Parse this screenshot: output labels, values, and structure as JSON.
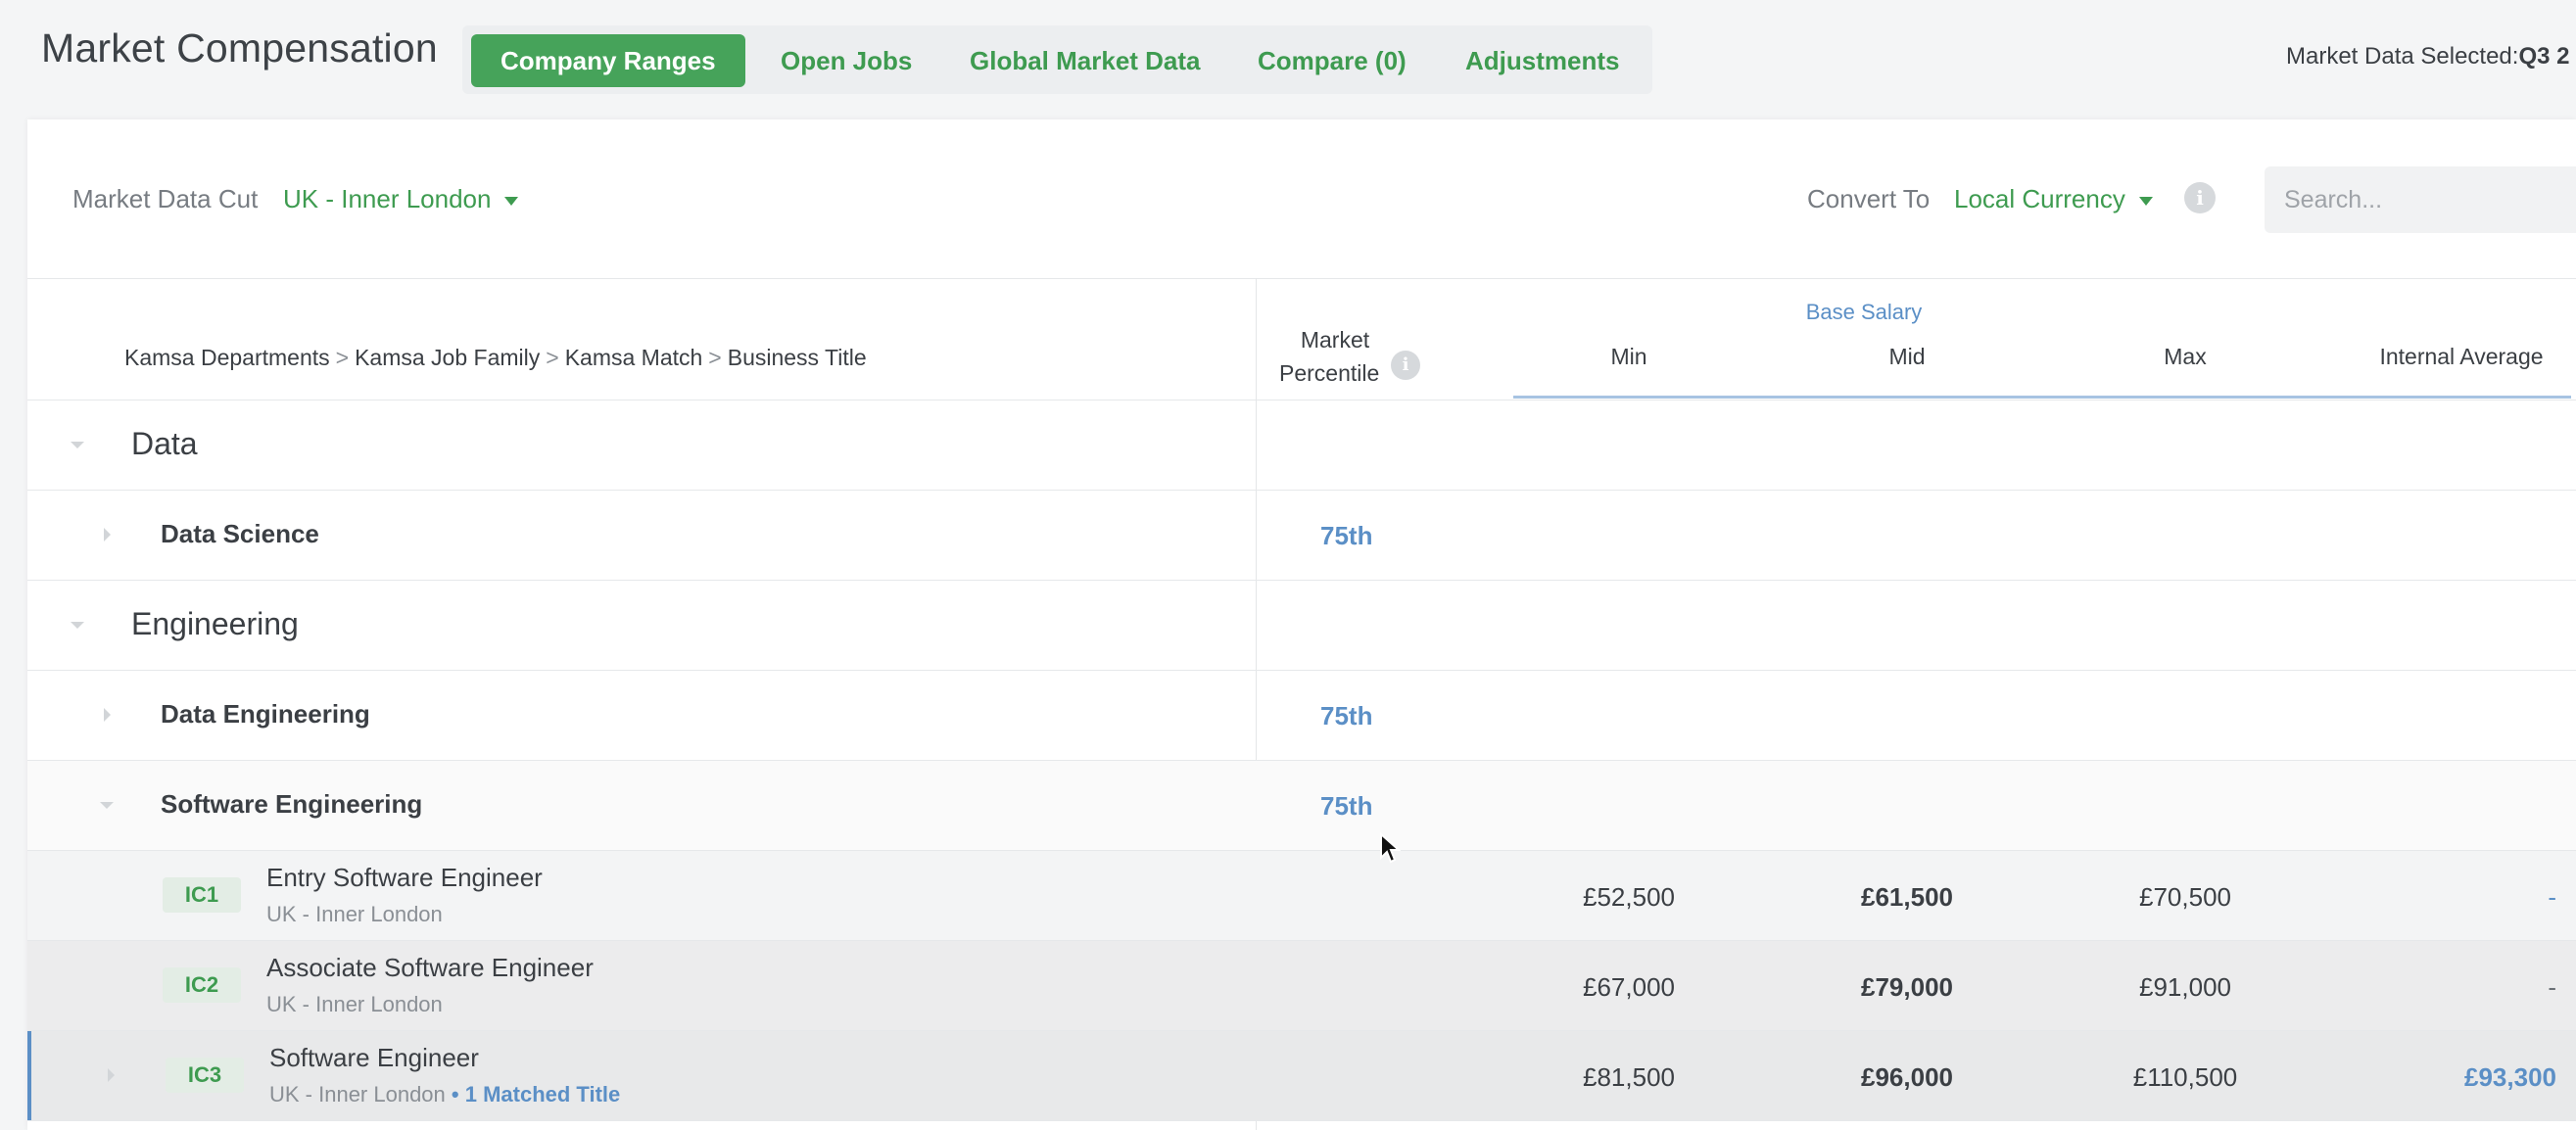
{
  "header": {
    "title": "Market Compensation",
    "tabs": [
      {
        "label": "Company Ranges"
      },
      {
        "label": "Open Jobs"
      },
      {
        "label": "Global Market Data"
      },
      {
        "label": "Compare (0)"
      },
      {
        "label": "Adjustments"
      }
    ],
    "market_selected_label": "Market Data Selected:",
    "market_selected_value": "Q3 2"
  },
  "filters": {
    "cut_label": "Market Data Cut",
    "cut_value": "UK - Inner London",
    "convert_label": "Convert To",
    "convert_value": "Local Currency",
    "search_placeholder": "Search..."
  },
  "table": {
    "breadcrumb": [
      "Kamsa Departments",
      "Kamsa Job Family",
      "Kamsa Match",
      "Business Title"
    ],
    "breadcrumb_sep": ">",
    "market_percentile_line1": "Market",
    "market_percentile_line2": "Percentile",
    "base_salary_label": "Base Salary",
    "columns": {
      "min": "Min",
      "mid": "Mid",
      "max": "Max",
      "internal_average": "Internal Average"
    },
    "departments": [
      {
        "name": "Data"
      },
      {
        "name": "Engineering"
      }
    ],
    "families": [
      {
        "name": "Data Science",
        "percentile": "75th"
      },
      {
        "name": "Data Engineering",
        "percentile": "75th"
      },
      {
        "name": "Software Engineering",
        "percentile": "75th"
      }
    ],
    "jobs": [
      {
        "level": "IC1",
        "title": "Entry Software Engineer",
        "location": "UK - Inner London",
        "matched": "",
        "min": "£52,500",
        "mid": "£61,500",
        "max": "£70,500",
        "avg": "-"
      },
      {
        "level": "IC2",
        "title": "Associate Software Engineer",
        "location": "UK - Inner London",
        "matched": "",
        "min": "£67,000",
        "mid": "£79,000",
        "max": "£91,000",
        "avg": "-"
      },
      {
        "level": "IC3",
        "title": "Software Engineer",
        "location": "UK - Inner London",
        "matched": "• 1 Matched Title",
        "min": "£81,500",
        "mid": "£96,000",
        "max": "£110,500",
        "avg": "£93,300"
      }
    ]
  },
  "colors": {
    "accent_green": "#46a35a",
    "link_blue": "#5b8fc6"
  },
  "icons": {
    "info": "info-icon",
    "caret": "caret-down-icon",
    "cursor": "mouse-pointer-icon"
  }
}
